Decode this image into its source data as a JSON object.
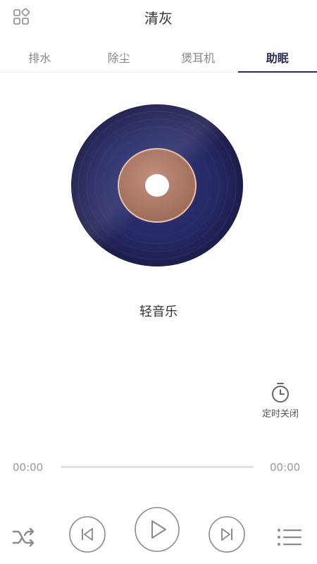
{
  "header": {
    "title": "清灰",
    "left_icon": "grid-apps-icon"
  },
  "tabs": [
    {
      "label": "排水",
      "active": false
    },
    {
      "label": "除尘",
      "active": false
    },
    {
      "label": "煲耳机",
      "active": false
    },
    {
      "label": "助眠",
      "active": true
    }
  ],
  "player": {
    "track_name": "轻音乐",
    "timer_label": "定时关闭",
    "current_time": "00:00",
    "total_time": "00:00",
    "progress": 0
  },
  "controls": {
    "shuffle_icon": "shuffle-icon",
    "prev_icon": "skip-previous-icon",
    "play_icon": "play-icon",
    "next_icon": "skip-next-icon",
    "list_icon": "playlist-icon"
  },
  "colors": {
    "accent": "#2a2d55",
    "disc": "#25275e",
    "label": "#b7836f",
    "icon": "#8a8a8a"
  }
}
